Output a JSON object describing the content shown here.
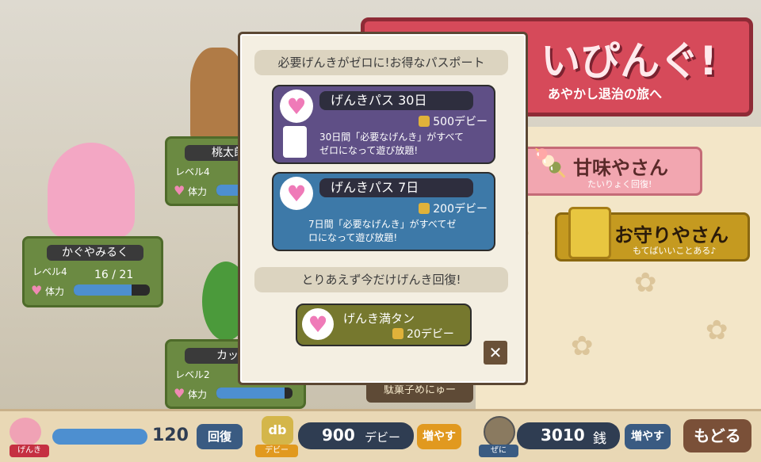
{
  "banner": {
    "title": "いぴんぐ!",
    "subtitle": "あやかし退治の旅へ"
  },
  "shops": {
    "sweets": {
      "label": "甘味やさん",
      "sub": "たいりょく回復!"
    },
    "omamori": {
      "label": "お守りやさん",
      "sub": "もてばいいことある♪"
    },
    "dagashi": "駄菓子めにゅー"
  },
  "characters": [
    {
      "name": "かぐやみるく",
      "level_label": "レベル4",
      "hp_label": "体力",
      "hp_text": "16 / 21",
      "hp_ratio": 0.76
    },
    {
      "name": "桃太郎",
      "level_label": "レベル4",
      "hp_label": "体力",
      "hp_ratio": 0.7
    },
    {
      "name": "カッパ",
      "level_label": "レベル2",
      "hp_label": "体力",
      "hp_ratio": 0.9
    }
  ],
  "dialog": {
    "header": "必要げんきがゼロに!お得なパスポート",
    "passes": [
      {
        "title": "げんきパス 30日",
        "price": "500デビー",
        "desc": "30日間「必要なげんき」がすべて\nゼロになって遊び放題!",
        "color": "#5f4f86"
      },
      {
        "title": "げんきパス 7日",
        "price": "200デビー",
        "desc": "7日間「必要なげんき」がすべてゼ\nロになって遊び放題!",
        "color": "#3d79a8"
      }
    ],
    "recover_header": "とりあえず今だけげんき回復!",
    "full_recover": {
      "title": "げんき満タン",
      "price": "20デビー"
    },
    "close_symbol": "✕"
  },
  "bottom": {
    "genki_label": "げんき",
    "genki_value": "120",
    "genki_ratio": 1.0,
    "recover_btn": "回復",
    "debi_icon": "db",
    "debi_label": "デビー",
    "debi_value": "900",
    "debi_unit": "デビー",
    "add_btn": "増やす",
    "zeni_label": "ぜに",
    "zeni_value": "3010",
    "zeni_unit": "銭",
    "add_btn2": "増やす",
    "back_btn": "もどる"
  },
  "colors": {
    "pass30": "#5f4f86",
    "pass7": "#3d79a8",
    "recover": "#76782e",
    "banner": "#d64a5a"
  }
}
